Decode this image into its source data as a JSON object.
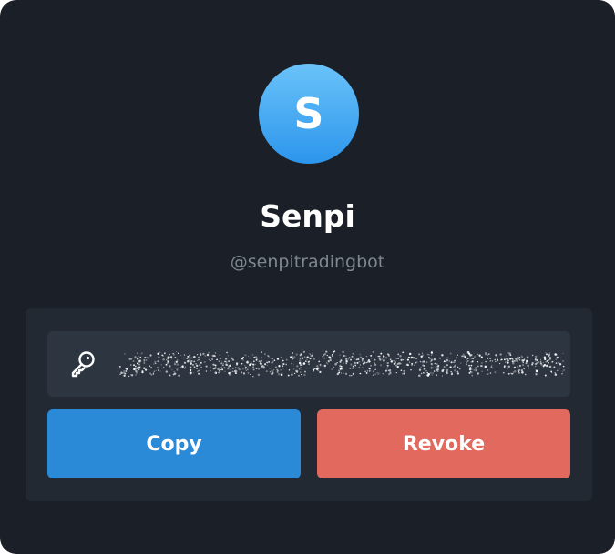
{
  "bot": {
    "avatar_letter": "S",
    "name": "Senpi",
    "username": "@senpitradingbot"
  },
  "token": {
    "hidden": true,
    "icon": "key-icon"
  },
  "actions": {
    "copy_label": "Copy",
    "revoke_label": "Revoke"
  },
  "colors": {
    "background": "#1b2028",
    "card": "#232932",
    "field": "#2d3540",
    "copy_button": "#2a8ad8",
    "revoke_button": "#e2695e",
    "avatar_top": "#6ac3f9",
    "avatar_bottom": "#2c95ec"
  }
}
